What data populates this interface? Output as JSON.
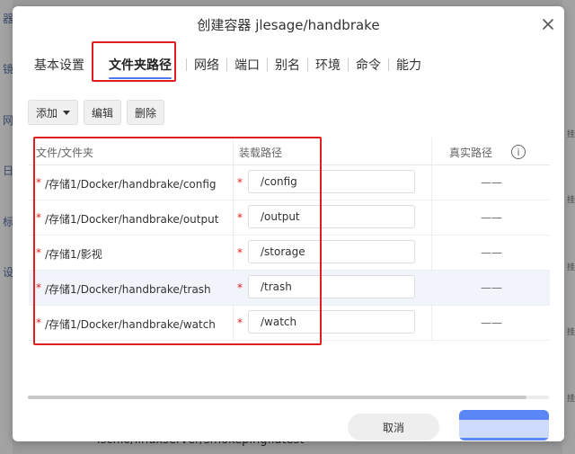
{
  "background": {
    "left_chars": [
      "器",
      "镜",
      "网",
      "日",
      "标",
      "设"
    ],
    "right_labels": [
      "挂",
      "挂",
      "挂",
      "挂",
      "挂",
      "挂"
    ],
    "bottom_text": "lscr.io/linuxserver/smokeping:latest"
  },
  "dialog": {
    "title": "创建容器 jlesage/handbrake",
    "tabs": [
      "基本设置",
      "文件夹路径",
      "网络",
      "端口",
      "别名",
      "环境",
      "命令",
      "能力"
    ],
    "active_tab": "文件夹路径"
  },
  "toolbar": {
    "add_label": "添加",
    "edit_label": "编辑",
    "delete_label": "删除"
  },
  "table": {
    "headers": {
      "file": "文件/文件夹",
      "mount": "装载路径",
      "real": "真实路径"
    },
    "rows": [
      {
        "file": "/存储1/Docker/handbrake/config",
        "mount": "/config",
        "real": "——"
      },
      {
        "file": "/存储1/Docker/handbrake/output",
        "mount": "/output",
        "real": "——"
      },
      {
        "file": "/存储1/影视",
        "mount": "/storage",
        "real": "——"
      },
      {
        "file": "/存储1/Docker/handbrake/trash",
        "mount": "/trash",
        "real": "——"
      },
      {
        "file": "/存储1/Docker/handbrake/watch",
        "mount": "/watch",
        "real": "——"
      }
    ],
    "required_mark": "*",
    "info_glyph": "i"
  },
  "footer": {
    "cancel_label": "取消"
  },
  "colors": {
    "accent": "#5b86f5",
    "highlight_box": "#e02020",
    "required": "#e02020"
  }
}
